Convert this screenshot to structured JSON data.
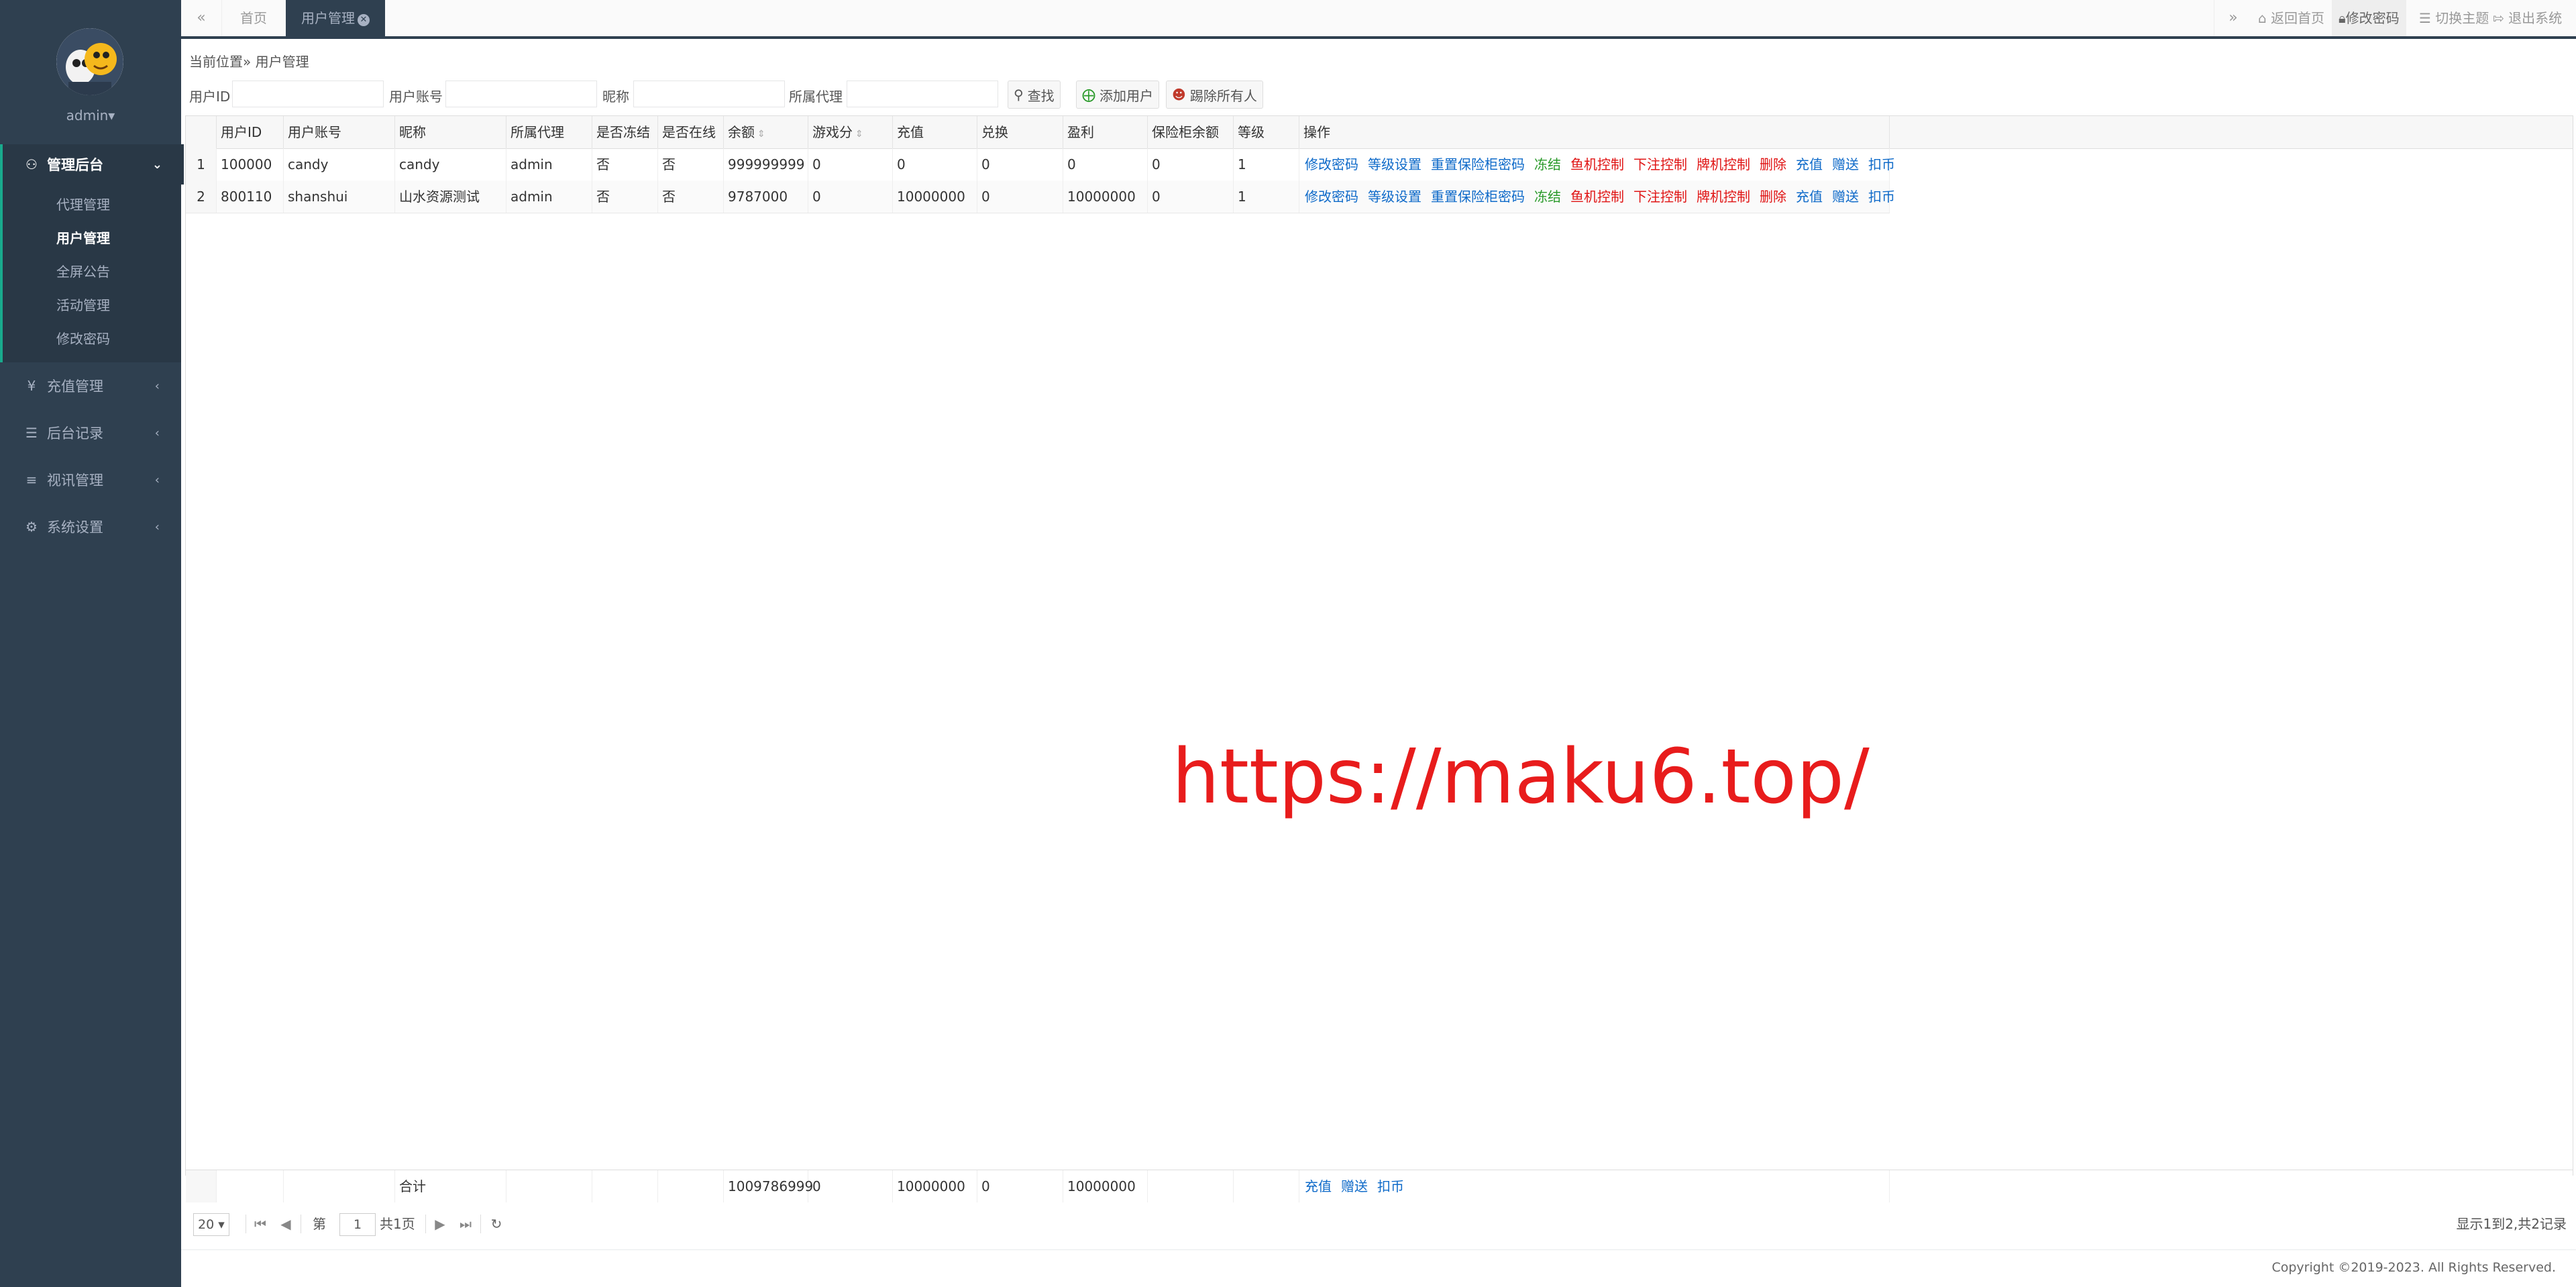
{
  "sidebar": {
    "user": "admin▾",
    "groups": [
      {
        "label": "管理后台",
        "icon": "users-icon"
      },
      {
        "label": "充值管理",
        "icon": "yen-icon"
      },
      {
        "label": "后台记录",
        "icon": "list-icon"
      },
      {
        "label": "视讯管理",
        "icon": "indent-icon"
      },
      {
        "label": "系统设置",
        "icon": "cogs-icon"
      }
    ],
    "admin_items": [
      "代理管理",
      "用户管理",
      "全屏公告",
      "活动管理",
      "修改密码"
    ],
    "active_item": "用户管理"
  },
  "tabs": {
    "back": "«",
    "home": "首页",
    "current": "用户管理",
    "forward": "»",
    "actions": {
      "home": "返回首页",
      "password": "修改密码",
      "theme": "切换主题",
      "exit": "退出系统"
    }
  },
  "breadcrumb": "当前位置» 用户管理",
  "search": {
    "user_id_label": "用户ID",
    "account_label": "用户账号",
    "nickname_label": "昵称",
    "agent_label": "所属代理",
    "find_button": "查找",
    "add_button": "添加用户",
    "kick_button": "踢除所有人"
  },
  "table": {
    "headers": [
      "用户ID",
      "用户账号",
      "昵称",
      "所属代理",
      "是否冻结",
      "是否在线",
      "余额",
      "游戏分",
      "充值",
      "兑换",
      "盈利",
      "保险柜余额",
      "等级",
      "操作"
    ],
    "rows": [
      {
        "n": "1",
        "cells": [
          "100000",
          "candy",
          "candy",
          "admin",
          "否",
          "否",
          "999999999",
          "0",
          "0",
          "0",
          "0",
          "0",
          "1"
        ]
      },
      {
        "n": "2",
        "cells": [
          "800110",
          "shanshui",
          "山水资源测试",
          "admin",
          "否",
          "否",
          "9787000",
          "0",
          "10000000",
          "0",
          "10000000",
          "0",
          "1"
        ]
      }
    ],
    "ops": [
      {
        "label": "修改密码",
        "color": "blue"
      },
      {
        "label": "等级设置",
        "color": "blue"
      },
      {
        "label": "重置保险柜密码",
        "color": "blue"
      },
      {
        "label": "冻结",
        "color": "green"
      },
      {
        "label": "鱼机控制",
        "color": "red"
      },
      {
        "label": "下注控制",
        "color": "red"
      },
      {
        "label": "牌机控制",
        "color": "red"
      },
      {
        "label": "删除",
        "color": "red"
      },
      {
        "label": "充值",
        "color": "blue"
      },
      {
        "label": "赠送",
        "color": "blue"
      },
      {
        "label": "扣币",
        "color": "blue"
      }
    ],
    "footer": {
      "label": "合计",
      "balance": "1009786999",
      "score": "0",
      "recharge": "10000000",
      "exchange": "0",
      "profit": "10000000",
      "ops": [
        "充值",
        "赠送",
        "扣币"
      ]
    }
  },
  "watermark": "https://maku6.top/",
  "pager": {
    "page_size": "20 ▾",
    "page_prefix": "第",
    "page": "1",
    "page_total": "共1页",
    "info": "显示1到2,共2记录"
  },
  "copyright": "Copyright ©2019-2023. All Rights Reserved."
}
